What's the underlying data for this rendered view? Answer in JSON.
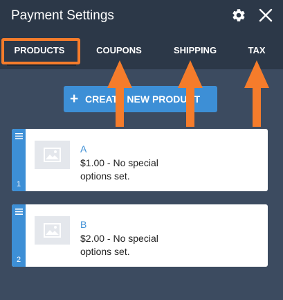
{
  "app": {
    "title": "Payment Settings"
  },
  "header": {
    "settings_icon": "gear-icon",
    "close_icon": "close-icon"
  },
  "tabs": [
    {
      "label": "PRODUCTS",
      "active": true
    },
    {
      "label": "COUPONS",
      "active": false
    },
    {
      "label": "SHIPPING",
      "active": false
    },
    {
      "label": "TAX",
      "active": false
    }
  ],
  "create_button": {
    "icon": "plus-icon",
    "label": "CREATE NEW PRODUCT"
  },
  "products": [
    {
      "index": "1",
      "name": "A",
      "description": "$1.00 - No special options set."
    },
    {
      "index": "2",
      "name": "B",
      "description": "$2.00 - No special options set."
    }
  ],
  "colors": {
    "header_bg": "#2c3848",
    "body_bg": "#3c4b60",
    "accent": "#3d8fd6",
    "annotation": "#f57c2b"
  }
}
